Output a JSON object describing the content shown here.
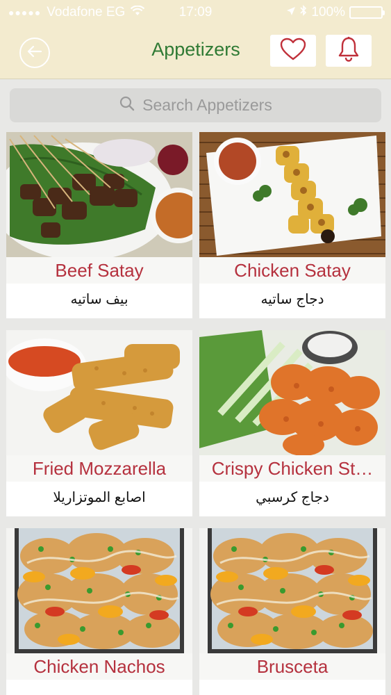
{
  "status_bar": {
    "signal": "●●●●●",
    "carrier": "Vodafone EG",
    "time": "17:09",
    "battery_text": "100%",
    "battery_level": 1.0
  },
  "nav": {
    "title": "Appetizers",
    "back_icon": "back-arrow-icon",
    "favorites_icon": "heart-icon",
    "notifications_icon": "bell-icon"
  },
  "search": {
    "placeholder": "Search Appetizers"
  },
  "colors": {
    "header_bg": "#f3ebcf",
    "title_green": "#2f7a34",
    "item_red": "#b5313e",
    "icon_red": "#c0303a"
  },
  "items": [
    {
      "name": "Beef Satay",
      "arabic": "بيف ساتيه"
    },
    {
      "name": "Chicken Satay",
      "arabic": "دجاج ساتيه"
    },
    {
      "name": "Fried Mozzarella",
      "arabic": "اصابع الموتزاريلا"
    },
    {
      "name": "Crispy Chicken St…",
      "arabic": "دجاج كرسبي"
    },
    {
      "name": "Chicken Nachos",
      "arabic": ""
    },
    {
      "name": "Brusceta",
      "arabic": ""
    }
  ]
}
